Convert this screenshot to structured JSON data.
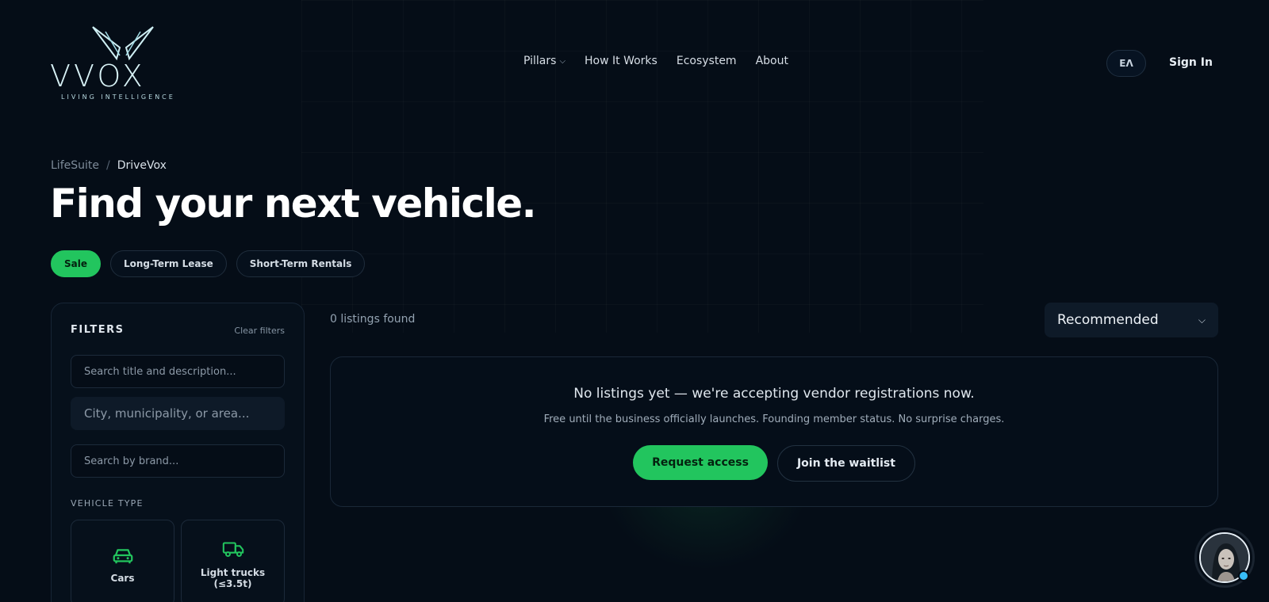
{
  "brand": {
    "name": "VVOX",
    "tagline": "LIVING INTELLIGENCE"
  },
  "nav": {
    "items": [
      {
        "label": "Pillars",
        "has_dropdown": true
      },
      {
        "label": "How It Works"
      },
      {
        "label": "Ecosystem"
      },
      {
        "label": "About"
      }
    ],
    "language": "ΕΛ",
    "sign_in": "Sign In"
  },
  "breadcrumb": {
    "parent": "LifeSuite",
    "separator": "/",
    "current": "DriveVox"
  },
  "page_title": "Find your next vehicle.",
  "tabs": [
    {
      "label": "Sale",
      "active": true
    },
    {
      "label": "Long-Term Lease",
      "active": false
    },
    {
      "label": "Short-Term Rentals",
      "active": false
    }
  ],
  "filters": {
    "title": "FILTERS",
    "clear_label": "Clear filters",
    "search_placeholder": "Search title and description...",
    "location_placeholder": "City, municipality, or area...",
    "brand_placeholder": "Search by brand...",
    "vehicle_type_label": "VEHICLE TYPE",
    "vehicle_types": [
      {
        "label": "Cars",
        "icon": "car-icon"
      },
      {
        "label": "Light trucks (≤3.5t)",
        "icon": "truck-icon"
      }
    ]
  },
  "results": {
    "count_text": "0 listings found",
    "sort_value": "Recommended"
  },
  "empty_state": {
    "message": "No listings yet — we're accepting vendor registrations now.",
    "sub": "Free until the business officially launches. Founding member status. No surprise charges.",
    "primary_cta": "Request access",
    "secondary_cta": "Join the waitlist"
  },
  "colors": {
    "accent": "#22c55e",
    "background": "#050d17",
    "status_dot": "#38bdf8"
  }
}
